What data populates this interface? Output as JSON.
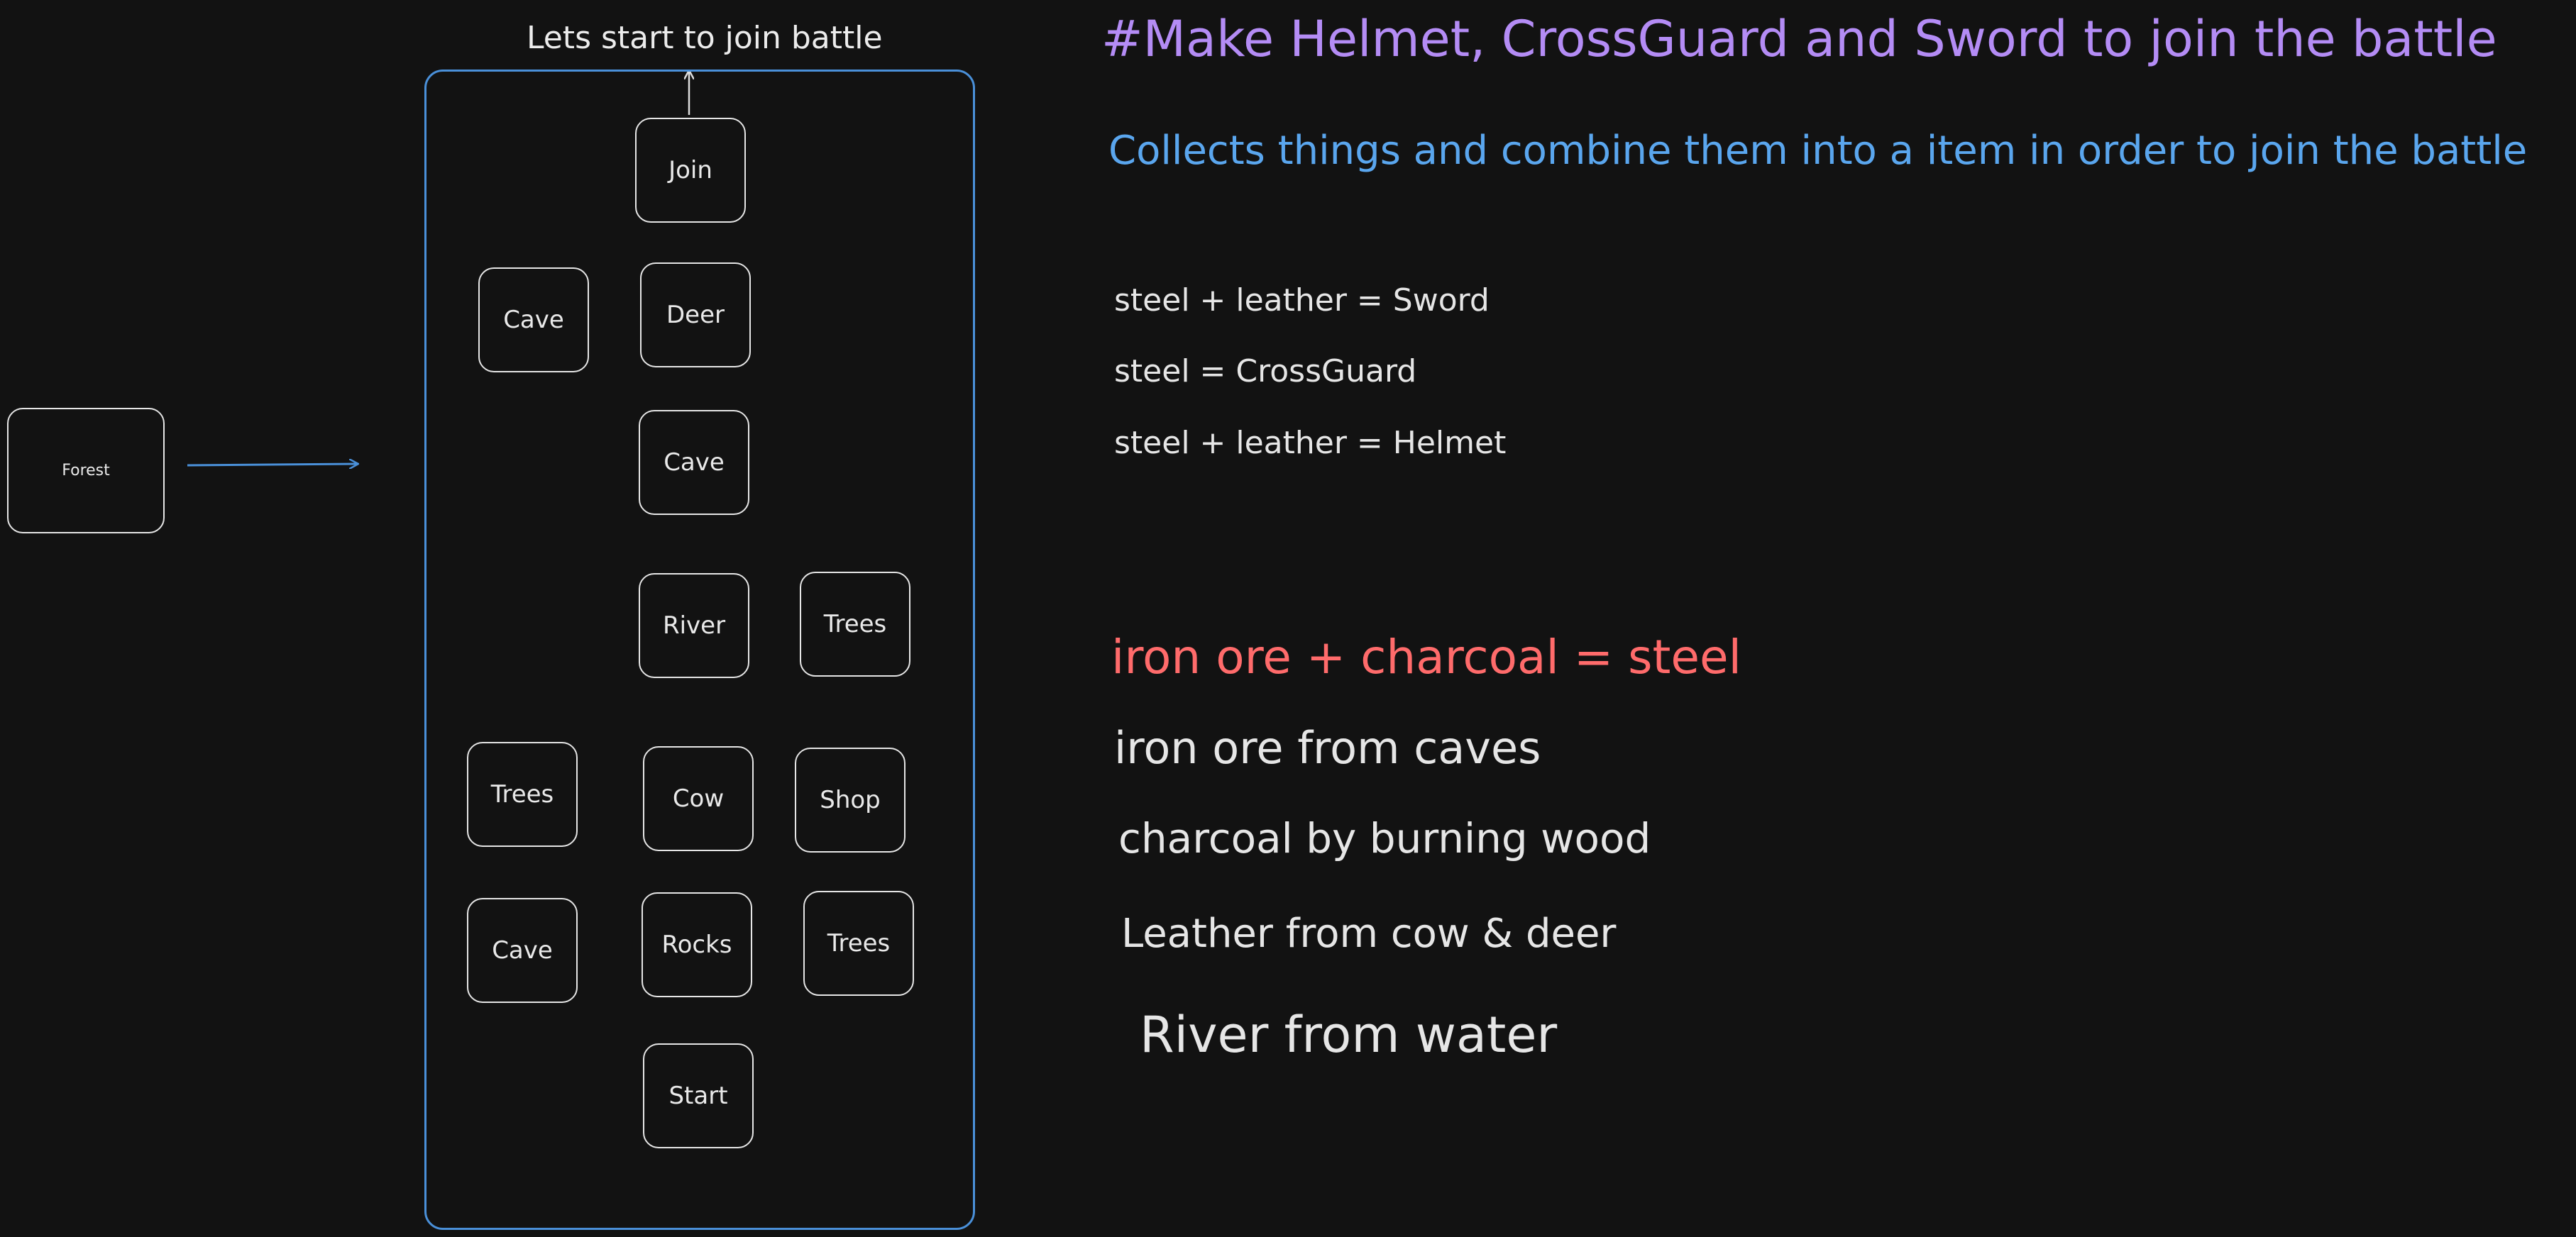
{
  "panel": {
    "title": "Lets start to join battle"
  },
  "forest": {
    "label": "Forest"
  },
  "nodes": [
    {
      "label": "Join"
    },
    {
      "label": "Cave"
    },
    {
      "label": "Deer"
    },
    {
      "label": "Cave"
    },
    {
      "label": "River"
    },
    {
      "label": "Trees"
    },
    {
      "label": "Trees"
    },
    {
      "label": "Cow"
    },
    {
      "label": "Shop"
    },
    {
      "label": "Cave"
    },
    {
      "label": "Rocks"
    },
    {
      "label": "Trees"
    },
    {
      "label": "Start"
    }
  ],
  "notes": {
    "heading": "#Make Helmet, CrossGuard and Sword to join the battle",
    "subtitle": "Collects things and combine them into a item in order to join the battle",
    "recipes": [
      "steel  + leather = Sword",
      "steel = CrossGuard",
      "steel + leather = Helmet"
    ],
    "steel_recipe": "iron ore + charcoal = steel",
    "sources": [
      "iron ore from caves",
      "charcoal by burning wood",
      "Leather from cow & deer",
      "River from water"
    ]
  },
  "colors": {
    "background": "#121212",
    "panel_border": "#4a90d9",
    "heading": "#b48cf5",
    "subtitle": "#5aa6ee",
    "steel_recipe": "#ff6b6b",
    "node_border": "#e6e6e6"
  }
}
